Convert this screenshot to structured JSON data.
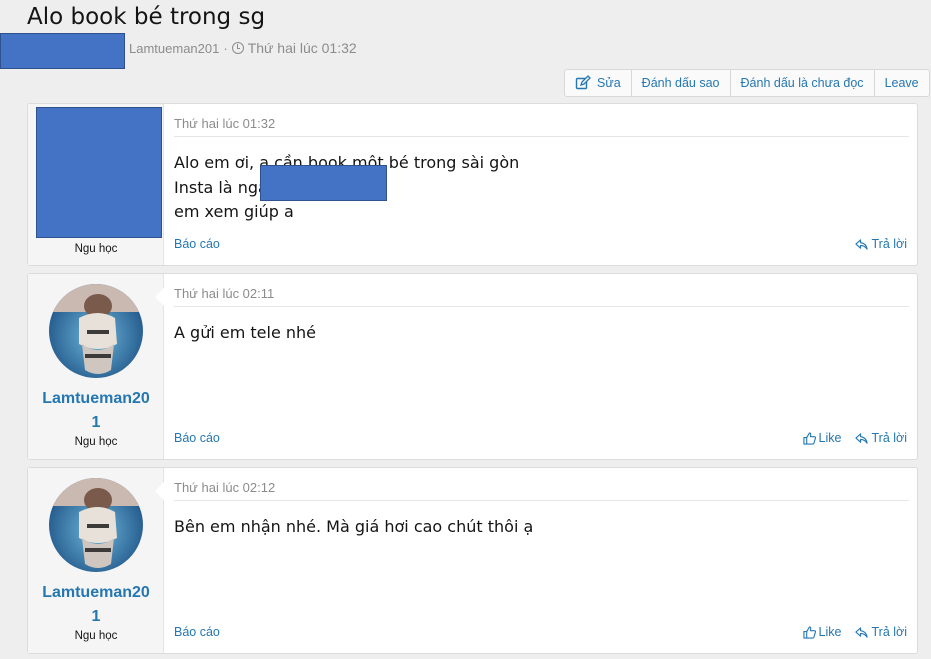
{
  "thread": {
    "title": "Alo book bé trong sg",
    "author": "Lamtueman201",
    "separator": "·",
    "time": "Thứ hai lúc 01:32"
  },
  "actions": {
    "edit": "Sửa",
    "bookmark": "Đánh dấu sao",
    "mark_unread": "Đánh dấu là chưa đọc",
    "leave": "Leave"
  },
  "posts": [
    {
      "date": "Thứ hai lúc 01:32",
      "lines": [
        "Alo em ơi, a cần book một bé trong sài gòn",
        "Insta là nga",
        "em xem giúp a"
      ],
      "username": "",
      "user_title": "Ngu học",
      "report": "Báo cáo",
      "reply": "Trả lời"
    },
    {
      "date": "Thứ hai lúc 02:11",
      "lines": [
        "A gửi em tele nhé"
      ],
      "username": "Lamtueman201",
      "user_title": "Ngu học",
      "report": "Báo cáo",
      "like": "Like",
      "reply": "Trả lời"
    },
    {
      "date": "Thứ hai lúc 02:12",
      "lines": [
        "Bên em nhận nhé. Mà giá hơi cao chút thôi ạ"
      ],
      "username": "Lamtueman201",
      "user_title": "Ngu học",
      "report": "Báo cáo",
      "like": "Like",
      "reply": "Trả lời"
    }
  ],
  "colors": {
    "link": "#2577b1",
    "muted": "#8c8c8c",
    "redaction": "#4472c4",
    "background": "#eeeeee"
  },
  "icons": [
    "clock-icon",
    "edit-icon",
    "reply-icon",
    "thumbs-up-icon"
  ]
}
